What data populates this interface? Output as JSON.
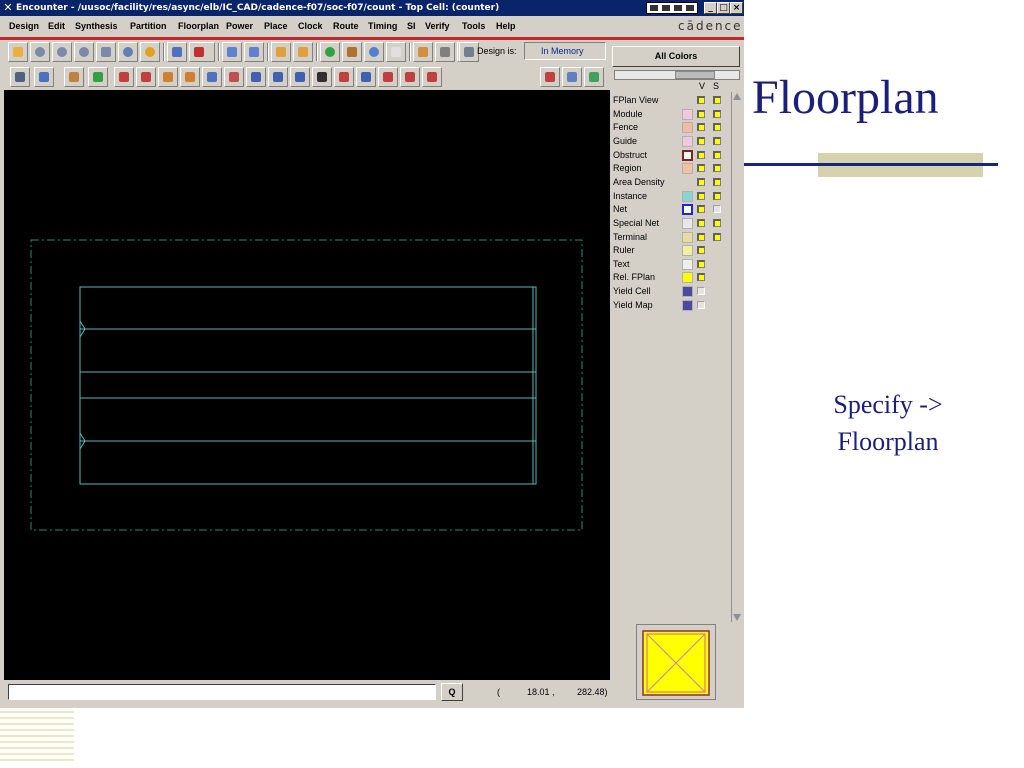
{
  "window": {
    "title": "Encounter - /uusoc/facility/res/async/elb/IC_CAD/cadence-f07/soc-f07/count - Top Cell: (counter)",
    "controls": [
      "_",
      "□",
      "×"
    ]
  },
  "menubar": {
    "items": [
      "Design",
      "Edit",
      "Synthesis",
      "Partition",
      "Floorplan",
      "Power",
      "Place",
      "Clock",
      "Route",
      "Timing",
      "SI",
      "Verify",
      "Tools",
      "Help"
    ],
    "brand": "cādence"
  },
  "toolbar": {
    "design_is_label": "Design is:",
    "design_is_value": "In Memory"
  },
  "layer_panel": {
    "all_colors_label": "All Colors",
    "col_v": "V",
    "col_s": "S",
    "layers": [
      {
        "label": "FPlan View",
        "color": "",
        "v": true,
        "s": true
      },
      {
        "label": "Module",
        "color": "#f2c8de",
        "v": true,
        "s": true
      },
      {
        "label": "Fence",
        "color": "#f5b8a0",
        "v": true,
        "s": true
      },
      {
        "label": "Guide",
        "color": "#f2c8de",
        "v": true,
        "s": true
      },
      {
        "label": "Obstruct",
        "color": "#8b2020",
        "v": true,
        "s": true
      },
      {
        "label": "Region",
        "color": "#f5c0a0",
        "v": true,
        "s": true
      },
      {
        "label": "Area Density",
        "color": "",
        "v": true,
        "s": true
      },
      {
        "label": "Instance",
        "color": "#88d4d4",
        "v": true,
        "s": true
      },
      {
        "label": "Net",
        "color": "#1a2ad0",
        "v": true,
        "s": false
      },
      {
        "label": "Special Net",
        "color": "#e8e8e8",
        "v": true,
        "s": true
      },
      {
        "label": "Terminal",
        "color": "#e8dca0",
        "v": true,
        "s": true
      },
      {
        "label": "Ruler",
        "color": "#f0f0a0",
        "v": true,
        "s": null
      },
      {
        "label": "Text",
        "color": "#eeeeee",
        "v": true,
        "s": null
      },
      {
        "label": "Rel. FPlan",
        "color": "#ffff00",
        "v": true,
        "s": null
      },
      {
        "label": "Yield Cell",
        "color": "#4a4aa0",
        "v": false,
        "s": null
      },
      {
        "label": "Yield Map",
        "color": "#4a4aa0",
        "v": false,
        "s": null
      }
    ]
  },
  "statusbar": {
    "q_button": "Q",
    "coord_open": "(",
    "coord_x": "18.01 ,",
    "coord_y": "282.48)"
  },
  "slide": {
    "title": "Floorplan",
    "body_line1": "Specify ->",
    "body_line2": "Floorplan"
  },
  "colors": {
    "title_text": "#1b1f7a",
    "canvas_bg": "#000000",
    "row_outline": "#58b8b8",
    "die_outline": "#2a8a70",
    "accent_red": "#c0282d"
  }
}
